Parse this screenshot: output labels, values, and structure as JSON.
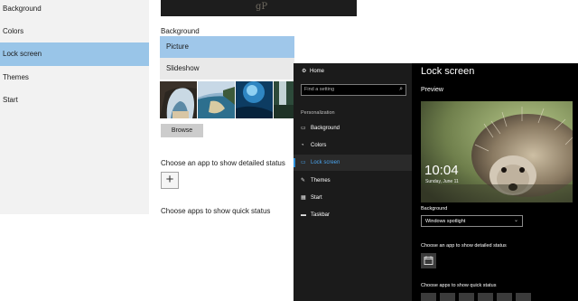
{
  "light_window": {
    "sidebar": {
      "items": [
        {
          "label": "Background",
          "selected": false
        },
        {
          "label": "Colors",
          "selected": false
        },
        {
          "label": "Lock screen",
          "selected": true
        },
        {
          "label": "Themes",
          "selected": false
        },
        {
          "label": "Start",
          "selected": false
        }
      ]
    },
    "content": {
      "watermark": "gP",
      "background_label": "Background",
      "options": [
        "Picture",
        "Slideshow"
      ],
      "browse_label": "Browse",
      "detailed_status_label": "Choose an app to show detailed status",
      "add_symbol": "+",
      "quick_status_label": "Choose apps to show quick status"
    }
  },
  "dark_window": {
    "nav": {
      "home_label": "Home",
      "search_placeholder": "Find a setting",
      "section_label": "Personalization",
      "items": [
        {
          "label": "Background",
          "icon": "picture-icon"
        },
        {
          "label": "Colors",
          "icon": "palette-icon"
        },
        {
          "label": "Lock screen",
          "icon": "monitor-icon"
        },
        {
          "label": "Themes",
          "icon": "brush-icon"
        },
        {
          "label": "Start",
          "icon": "start-icon"
        },
        {
          "label": "Taskbar",
          "icon": "taskbar-icon"
        }
      ]
    },
    "page": {
      "title": "Lock screen",
      "preview_label": "Preview",
      "preview_time": "10:04",
      "preview_date": "Sunday, June 11",
      "background_label": "Background",
      "background_value": "Windows spotlight",
      "detailed_status_label": "Choose an app to show detailed status",
      "quick_status_label": "Choose apps to show quick status"
    }
  },
  "colors": {
    "accent": "#2d8fd9",
    "selection_light": "#99c5e8",
    "dark_bg": "#000000",
    "dark_nav_bg": "#1b1b1b"
  }
}
